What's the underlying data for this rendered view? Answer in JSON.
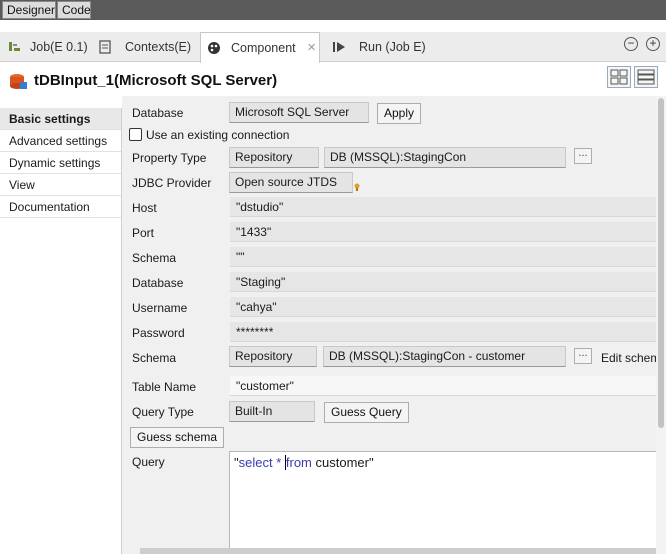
{
  "top_tabs": {
    "designer": "Designer",
    "code": "Code"
  },
  "view_tabs": [
    {
      "label": "Job(E 0.1)",
      "icon": "job-icon"
    },
    {
      "label": "Contexts(E)",
      "icon": "contexts-icon"
    },
    {
      "label": "Component",
      "icon": "component-icon",
      "active": true
    },
    {
      "label": "Run (Job E)",
      "icon": "run-icon"
    }
  ],
  "component": {
    "title": "tDBInput_1(Microsoft SQL Server)",
    "icon": "database-icon"
  },
  "nav": [
    "Basic settings",
    "Advanced settings",
    "Dynamic settings",
    "View",
    "Documentation"
  ],
  "form": {
    "database_label": "Database",
    "database_value": "Microsoft SQL Server",
    "apply_label": "Apply",
    "use_existing_label": "Use an existing connection",
    "property_type_label": "Property Type",
    "property_type_value": "Repository",
    "property_repo_value": "DB (MSSQL):StagingCon",
    "jdbc_label": "JDBC Provider",
    "jdbc_value": "Open source JTDS",
    "host_label": "Host",
    "host_value": "\"dstudio\"",
    "port_label": "Port",
    "port_value": "\"1433\"",
    "schema_label": "Schema",
    "schema_value": "\"\"",
    "db_label": "Database",
    "db_value": "\"Staging\"",
    "username_label": "Username",
    "username_value": "\"cahya\"",
    "password_label": "Password",
    "password_value": "********",
    "schema2_label": "Schema",
    "schema2_type": "Repository",
    "schema2_repo": "DB (MSSQL):StagingCon - customer",
    "edit_schema_label": "Edit schema",
    "table_label": "Table Name",
    "table_value": "\"customer\"",
    "query_type_label": "Query Type",
    "query_type_value": "Built-In",
    "guess_query_label": "Guess Query",
    "guess_schema_label": "Guess schema",
    "query_label": "Query",
    "query_parts": {
      "q1": "\"",
      "kw1": "select",
      "op": " * ",
      "kw2": "from",
      "rest": " customer\""
    }
  },
  "colors": {
    "keyword": "#3b3bb0",
    "tab_strip": "#5a5a5a",
    "title_icon": "#d9531e"
  }
}
